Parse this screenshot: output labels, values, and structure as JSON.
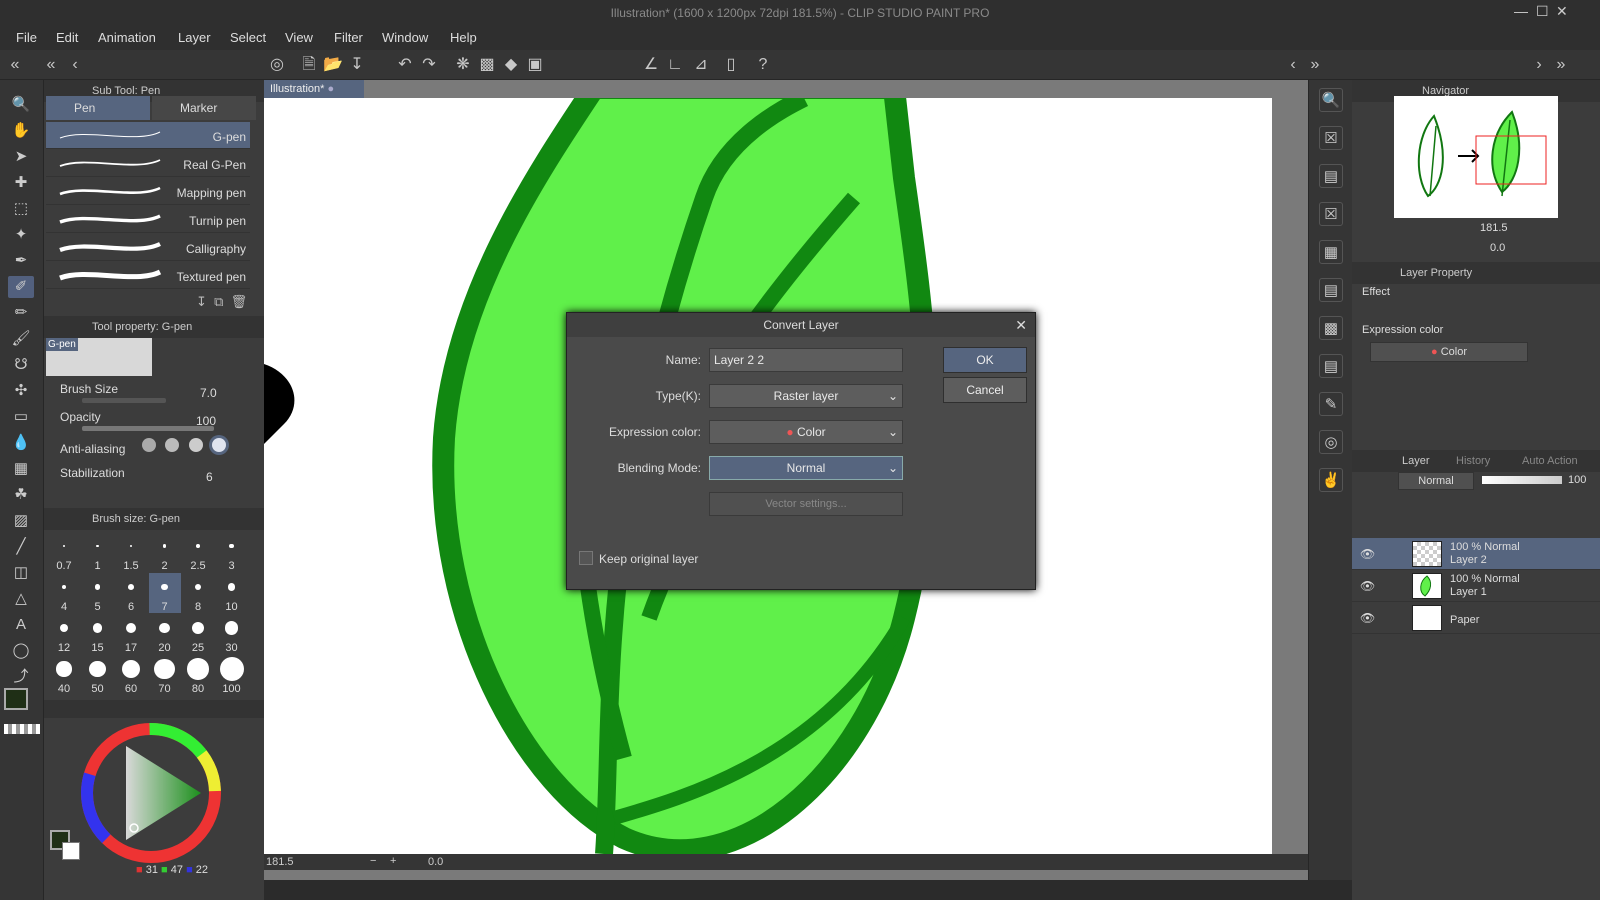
{
  "window": {
    "title": "Illustration* (1600 x 1200px 72dpi 181.5%) - CLIP STUDIO PAINT PRO"
  },
  "menu": [
    "File",
    "Edit",
    "Animation",
    "Layer",
    "Select",
    "View",
    "Filter",
    "Window",
    "Help"
  ],
  "sub_tool": {
    "header": "Sub Tool: Pen",
    "tabs": [
      "Pen",
      "Marker"
    ],
    "brushes": [
      "G-pen",
      "Real G-Pen",
      "Mapping pen",
      "Turnip pen",
      "Calligraphy",
      "Textured pen"
    ],
    "selected_brush": "G-pen"
  },
  "tool_property": {
    "header": "Tool property: G-pen",
    "preview_label": "G-pen",
    "brush_size_label": "Brush Size",
    "brush_size": "7.0",
    "opacity_label": "Opacity",
    "opacity": "100",
    "antialias_label": "Anti-aliasing",
    "stabilization_label": "Stabilization",
    "stabilization": "6"
  },
  "brush_size_panel": {
    "header": "Brush size: G-pen",
    "sizes": [
      "0.7",
      "1",
      "1.5",
      "2",
      "2.5",
      "3",
      "4",
      "5",
      "6",
      "7",
      "8",
      "10",
      "12",
      "15",
      "17",
      "20",
      "25",
      "30",
      "40",
      "50",
      "60",
      "70",
      "80",
      "100"
    ],
    "selected": "7"
  },
  "color": {
    "rgb_r": "31",
    "rgb_g": "47",
    "rgb_b": "22",
    "main": "#1f2f16",
    "sub": "#ffffff"
  },
  "document": {
    "tab": "Illustration*",
    "zoom": "181.5",
    "angle": "0.0"
  },
  "dialog": {
    "title": "Convert Layer",
    "name_label": "Name:",
    "name_value": "Layer 2 2",
    "type_label": "Type(K):",
    "type_value": "Raster layer",
    "expr_label": "Expression color:",
    "expr_value": "Color",
    "blend_label": "Blending Mode:",
    "blend_value": "Normal",
    "vector_settings": "Vector settings...",
    "keep_original": "Keep original layer",
    "ok": "OK",
    "cancel": "Cancel"
  },
  "navigator": {
    "header": "Navigator",
    "zoom": "181.5",
    "angle": "0.0"
  },
  "layer_property": {
    "header": "Layer Property",
    "effect_label": "Effect",
    "expr_label": "Expression color",
    "expr_value": "Color"
  },
  "layer_panel": {
    "tabs": [
      "Layer",
      "History",
      "Auto Action"
    ],
    "blend_mode": "Normal",
    "opacity": "100",
    "layers": [
      {
        "mode": "100 % Normal",
        "name": "Layer 2"
      },
      {
        "mode": "100 % Normal",
        "name": "Layer 1"
      },
      {
        "mode": "",
        "name": "Paper"
      }
    ]
  },
  "accent": "#56657f"
}
